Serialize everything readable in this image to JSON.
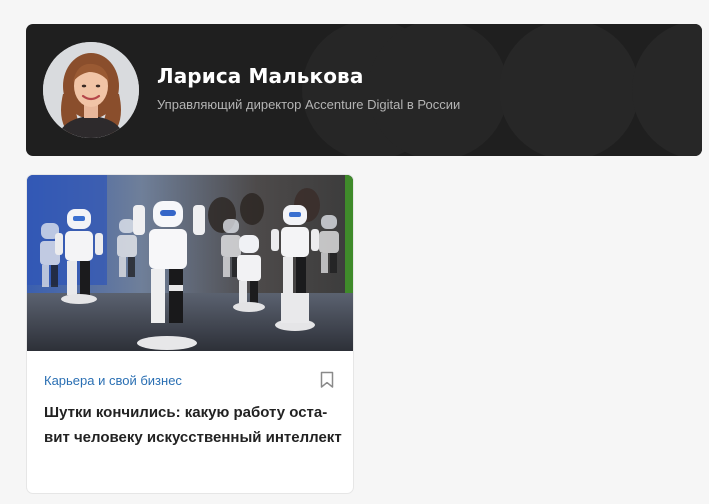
{
  "author": {
    "name": "Лариса Малькова",
    "role": "Управляющий директор Accenture Digital в России"
  },
  "article": {
    "category": "Карьера и свой бизнес",
    "title_lines": [
      "Шутки кончились: какую работу оста-",
      "вит человеку искусственный интеллект"
    ],
    "bookmark_icon": "bookmark-icon"
  },
  "colors": {
    "banner_background": "#1f1f1f",
    "category_link": "#2a6fb3",
    "title_text": "#222222",
    "page_background": "#f6f6f6"
  }
}
